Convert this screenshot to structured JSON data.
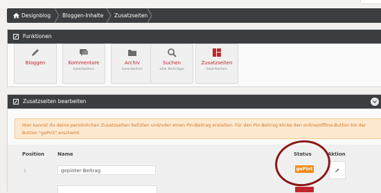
{
  "breadcrumb": {
    "items": [
      "Designblog",
      "Bloggen-Inhalte",
      "Zusatzseiten"
    ]
  },
  "functions_panel": {
    "title": "Funktionen",
    "tiles": [
      {
        "label": "Bloggen",
        "sub": "",
        "icon": "pencil-icon"
      },
      {
        "label": "Kommentare",
        "sub": "bearbeiten",
        "icon": "comment-icon"
      },
      {
        "label": "Archiv",
        "sub": "bearbeiten",
        "icon": "folder-icon"
      },
      {
        "label": "Suchen",
        "sub": "alte Beiträge",
        "icon": "search-icon"
      },
      {
        "label": "Zusatzseiten",
        "sub": "bearbeiten",
        "icon": "layout-icon"
      }
    ]
  },
  "pages_panel": {
    "title": "Zusatzseiten bearbeiten",
    "notice": "Hier kannst du deine persönlichen Zusatzseiten befüllen und/oder einen Pin-Beitrag erstellen. Für den Pin-Beitrag klicke den online/offline-Button bis der Button \"gePint\" erscheint.",
    "columns": {
      "position": "Position",
      "name": "Name",
      "status": "Status",
      "action": "Aktion"
    },
    "rows": [
      {
        "position": "1",
        "name": "gepinter Beitrag",
        "status": "gePint"
      }
    ]
  },
  "colors": {
    "accent": "#c0262b",
    "header": "#3b3d40",
    "status_pinned": "#ef8c1c",
    "annotation_circle": "#8b1515"
  }
}
